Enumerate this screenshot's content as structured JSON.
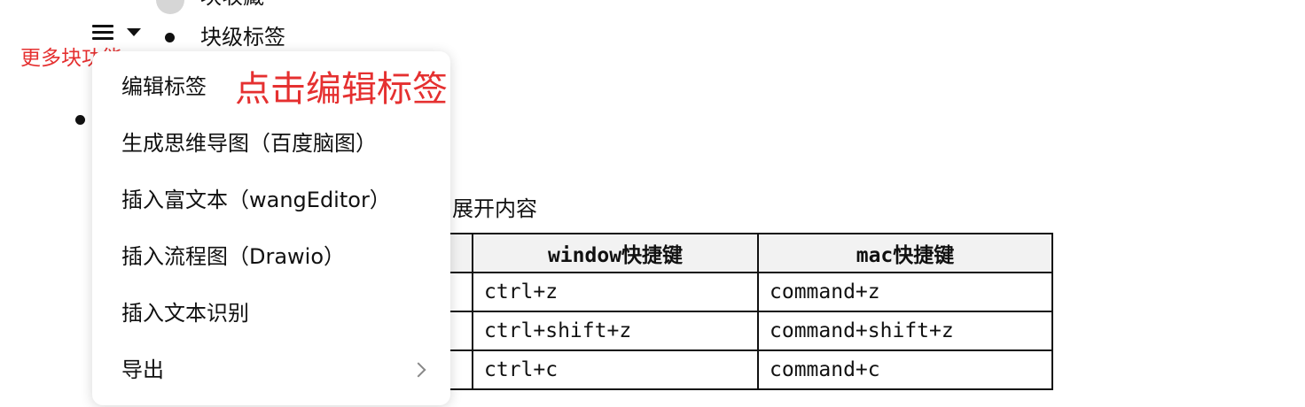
{
  "top_block": {
    "cut_text": "块收藏"
  },
  "menu_trigger": {
    "hamburger_icon": "menu-icon",
    "caret_icon": "caret-down-icon"
  },
  "block": {
    "tag_label": "块级标签"
  },
  "annotations": {
    "more_functions": "更多块功能",
    "edit_tag_hint": "点击编辑标签"
  },
  "block_menu": {
    "items": [
      {
        "label": "编辑标签"
      },
      {
        "label": "生成思维导图（百度脑图）"
      },
      {
        "label": "插入富文本（wangEditor）"
      },
      {
        "label": "插入流程图（Drawio）"
      },
      {
        "label": "插入文本识别"
      },
      {
        "label": "导出",
        "has_submenu": true,
        "icon": "chevron-right-icon"
      }
    ]
  },
  "background_text": {
    "expand": "展开内容"
  },
  "shortcut_table": {
    "headers": [
      "",
      "window快捷键",
      "mac快捷键"
    ],
    "rows": [
      [
        "",
        "ctrl+z",
        "command+z"
      ],
      [
        "",
        "ctrl+shift+z",
        "command+shift+z"
      ],
      [
        "",
        "ctrl+c",
        "command+c"
      ]
    ]
  },
  "colors": {
    "annotation_red": "#e53030",
    "table_header_bg": "#f2f2f2",
    "menu_bg": "#ffffff",
    "circle_grey": "#d6d6d6"
  }
}
